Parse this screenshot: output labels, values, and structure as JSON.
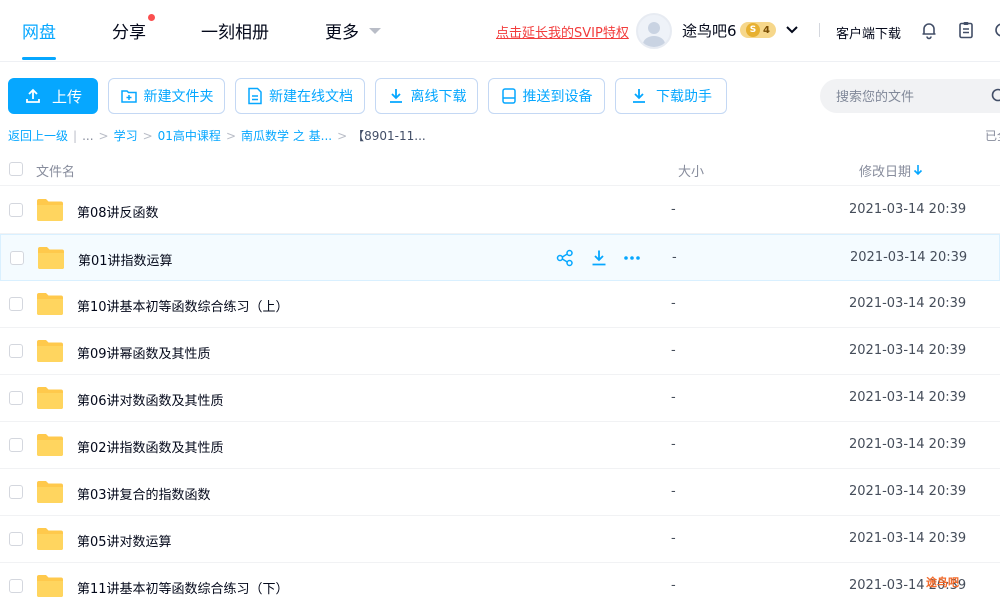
{
  "nav": {
    "tabs": [
      {
        "label": "网盘",
        "active": true
      },
      {
        "label": "分享",
        "active": false
      },
      {
        "label": "一刻相册",
        "active": false
      },
      {
        "label": "更多",
        "active": false
      }
    ],
    "promo": "点击延长我的SVIP特权",
    "username": "途鸟吧6",
    "vip_level": "4",
    "vip_prefix": "S",
    "client_download": "客户端下载",
    "accent_color": "#06a7ff"
  },
  "toolbar": {
    "upload": "上传",
    "new_folder": "新建文件夹",
    "new_doc": "新建在线文档",
    "offline_download": "离线下载",
    "push_device": "推送到设备",
    "download_helper": "下载助手",
    "search_placeholder": "搜索您的文件"
  },
  "breadcrumb": {
    "back": "返回上一级",
    "ellipsis": "...",
    "items": [
      "学习",
      "01高中课程",
      "南瓜数学 之 基...",
      "【8901-11..."
    ],
    "loaded": "已全"
  },
  "table": {
    "headers": {
      "name": "文件名",
      "size": "大小",
      "modified": "修改日期"
    },
    "sort_icon": "arrow-down-icon",
    "rows": [
      {
        "name": "第08讲反函数",
        "size": "-",
        "date": "2021-03-14 20:39"
      },
      {
        "name": "第01讲指数运算",
        "size": "-",
        "date": "2021-03-14 20:39"
      },
      {
        "name": "第10讲基本初等函数综合练习（上）",
        "size": "-",
        "date": "2021-03-14 20:39"
      },
      {
        "name": "第09讲幂函数及其性质",
        "size": "-",
        "date": "2021-03-14 20:39"
      },
      {
        "name": "第06讲对数函数及其性质",
        "size": "-",
        "date": "2021-03-14 20:39"
      },
      {
        "name": "第02讲指数函数及其性质",
        "size": "-",
        "date": "2021-03-14 20:39"
      },
      {
        "name": "第03讲复合的指数函数",
        "size": "-",
        "date": "2021-03-14 20:39"
      },
      {
        "name": "第05讲对数运算",
        "size": "-",
        "date": "2021-03-14 20:39"
      },
      {
        "name": "第11讲基本初等函数综合练习（下）",
        "size": "-",
        "date": "2021-03-14 20:39"
      }
    ]
  },
  "watermark": "途鸟吧"
}
